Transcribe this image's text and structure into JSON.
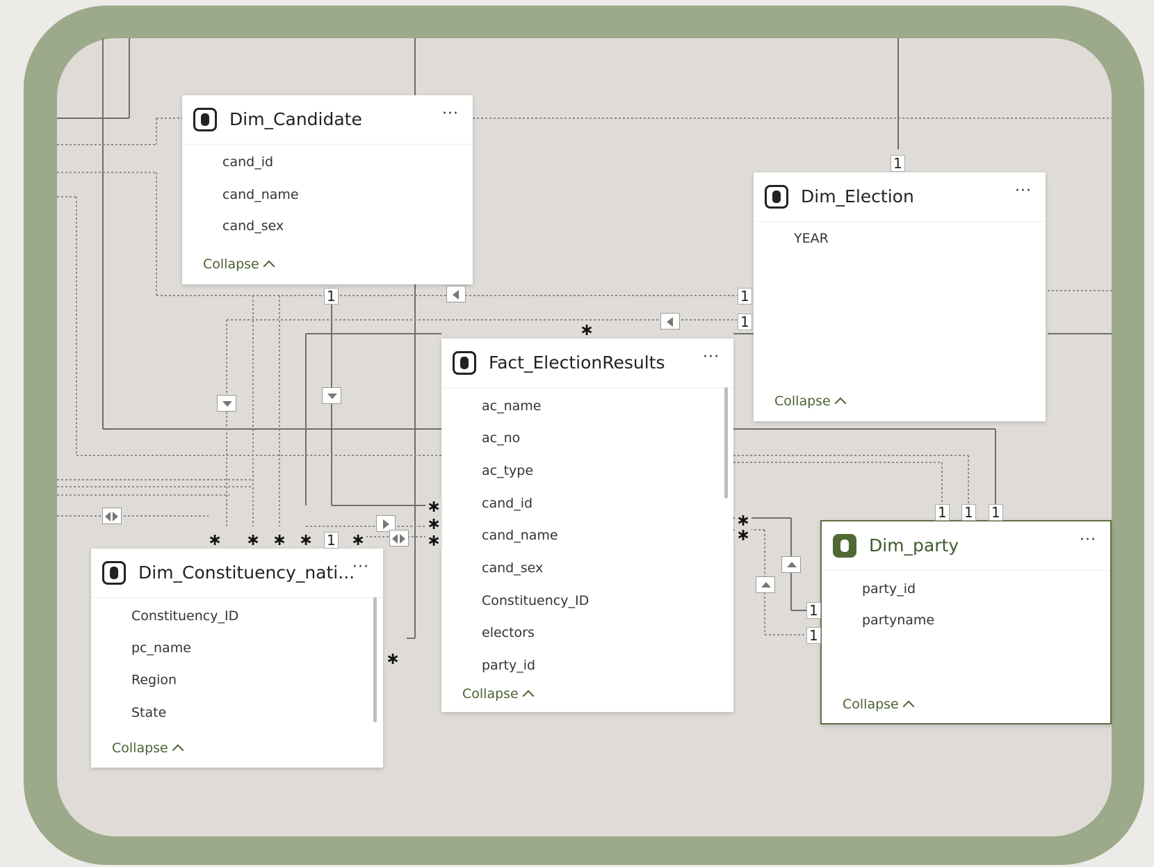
{
  "colors": {
    "frame": "#9ca98a",
    "canvas": "#dfdcd8",
    "accent": "#4f6a34",
    "collapse_text": "#4b6131"
  },
  "tables": {
    "candidate": {
      "title": "Dim_Candidate",
      "icon": "database-icon",
      "fields": [
        "cand_id",
        "cand_name",
        "cand_sex"
      ],
      "collapse_label": "Collapse"
    },
    "election": {
      "title": "Dim_Election",
      "icon": "database-icon",
      "fields": [
        "YEAR"
      ],
      "collapse_label": "Collapse"
    },
    "fact": {
      "title": "Fact_ElectionResults",
      "icon": "database-icon",
      "fields": [
        "ac_name",
        "ac_no",
        "ac_type",
        "cand_id",
        "cand_name",
        "cand_sex",
        "Constituency_ID",
        "electors",
        "party_id"
      ],
      "collapse_label": "Collapse"
    },
    "constituency": {
      "title": "Dim_Constituency_nati...",
      "icon": "database-icon",
      "fields": [
        "Constituency_ID",
        "pc_name",
        "Region",
        "State"
      ],
      "collapse_label": "Collapse"
    },
    "party": {
      "title": "Dim_party",
      "icon": "database-icon",
      "fields": [
        "party_id",
        "partyname"
      ],
      "collapse_label": "Collapse"
    }
  },
  "more_label": "···",
  "cardinality": {
    "one": "1",
    "many": "∗"
  }
}
